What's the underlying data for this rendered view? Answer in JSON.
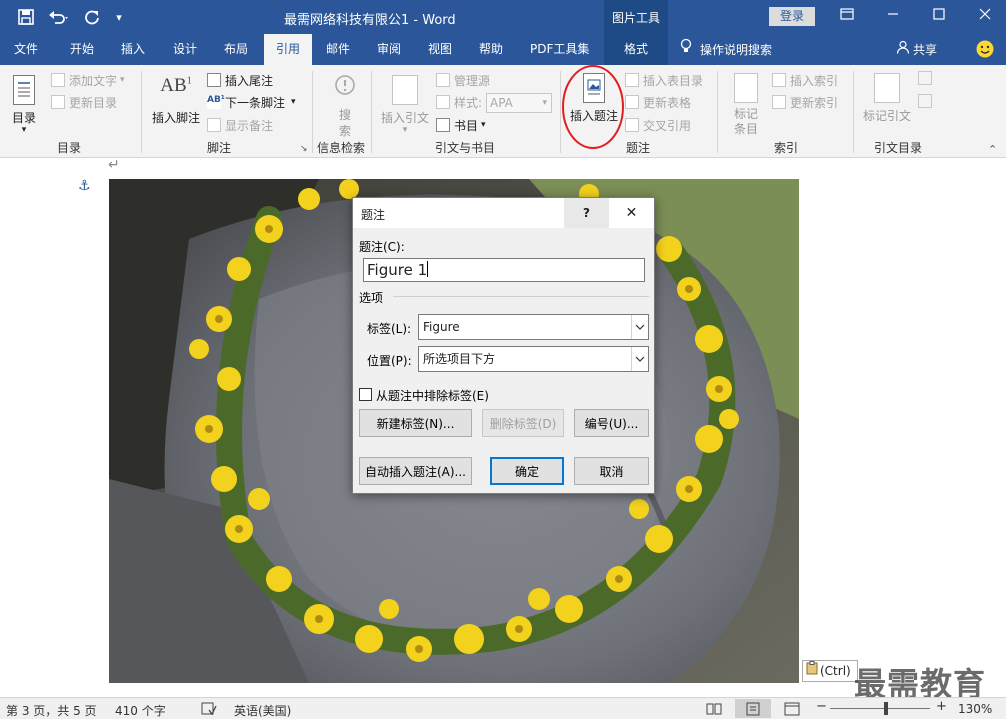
{
  "app": {
    "document_title": "最需网络科技有限公1 - Word",
    "context_tools": "图片工具",
    "login": "登录",
    "share": "共享",
    "tell_me": "操作说明搜索"
  },
  "tabs": [
    "文件",
    "开始",
    "插入",
    "设计",
    "布局",
    "引用",
    "邮件",
    "审阅",
    "视图",
    "帮助",
    "PDF工具集",
    "格式"
  ],
  "ribbon": {
    "toc": {
      "big": "目录",
      "add_text": "添加文字",
      "update": "更新目录",
      "label": "目录"
    },
    "footnotes": {
      "insert": "插入脚注",
      "endnote": "插入尾注",
      "next": "下一条脚注",
      "show": "显示备注",
      "label": "脚注"
    },
    "research": {
      "search": "搜索",
      "label": "信息检索"
    },
    "citations": {
      "insert": "插入引文",
      "manage": "管理源",
      "style_label": "样式:",
      "style_value": "APA",
      "biblio": "书目",
      "label": "引文与书目"
    },
    "captions": {
      "insert": "插入题注",
      "table_of_figures": "插入表目录",
      "update_table": "更新表格",
      "cross_ref": "交叉引用",
      "label": "题注"
    },
    "index": {
      "mark": "标记条目",
      "insert": "插入索引",
      "update": "更新索引",
      "label": "索引"
    },
    "toa": {
      "mark": "标记引文",
      "label": "引文目录"
    }
  },
  "dialog": {
    "title": "题注",
    "help": "?",
    "close": "✕",
    "caption_label": "题注(C):",
    "caption_value": "Figure 1",
    "options": "选项",
    "label_label": "标签(L):",
    "label_value": "Figure",
    "position_label": "位置(P):",
    "position_value": "所选项目下方",
    "exclude": "从题注中排除标签(E)",
    "new_label": "新建标签(N)...",
    "delete_label": "删除标签(D)",
    "numbering": "编号(U)...",
    "auto": "自动插入题注(A)...",
    "ok": "确定",
    "cancel": "取消"
  },
  "paste_options": "(Ctrl)",
  "watermark": "最需教育",
  "status": {
    "page": "第 3 页，共 5 页",
    "words": "410 个字",
    "lang": "英语(美国)",
    "zoom": "130%"
  },
  "accent": "#2b579a",
  "highlight": "#e02020"
}
